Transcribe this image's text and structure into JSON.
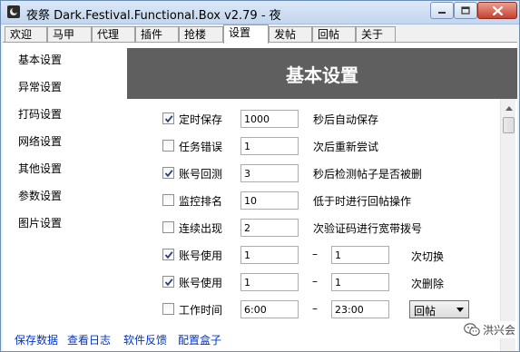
{
  "window": {
    "title": "夜祭 Dark.Festival.Functional.Box v2.79 -  夜"
  },
  "tabs": [
    {
      "label": "欢迎"
    },
    {
      "label": "马甲"
    },
    {
      "label": "代理"
    },
    {
      "label": "插件"
    },
    {
      "label": "抢楼"
    },
    {
      "label": "设置",
      "active": true
    },
    {
      "label": "发帖"
    },
    {
      "label": "回帖"
    },
    {
      "label": "关于"
    }
  ],
  "sidebar": {
    "items": [
      {
        "label": "基本设置"
      },
      {
        "label": "异常设置"
      },
      {
        "label": "打码设置"
      },
      {
        "label": "网络设置"
      },
      {
        "label": "其他设置"
      },
      {
        "label": "参数设置"
      },
      {
        "label": "图片设置"
      }
    ]
  },
  "panel": {
    "heading": "基本设置",
    "rows": [
      {
        "checked": true,
        "label": "定时保存",
        "value": "1000",
        "suffix": "秒后自动保存"
      },
      {
        "checked": false,
        "label": "任务错误",
        "value": "1",
        "suffix": "次后重新尝试"
      },
      {
        "checked": true,
        "label": "账号回测",
        "value": "3",
        "suffix": "秒后检测帖子是否被删"
      },
      {
        "checked": false,
        "label": "监控排名",
        "value": "10",
        "suffix": "低于时进行回帖操作"
      },
      {
        "checked": false,
        "label": "连续出现",
        "value": "2",
        "suffix": "次验证码进行宽带拨号"
      },
      {
        "checked": true,
        "label": "账号使用",
        "value": "1",
        "separator": "–",
        "value2": "1",
        "suffix": "次切换"
      },
      {
        "checked": true,
        "label": "账号使用",
        "value": "1",
        "separator": "–",
        "value2": "1",
        "suffix": "次删除"
      },
      {
        "checked": false,
        "label": "工作时间",
        "value": "6:00",
        "separator": "–",
        "value2": "23:00",
        "select": "回帖"
      }
    ]
  },
  "footer": {
    "links": [
      {
        "label": "保存数据"
      },
      {
        "label": "查看日志"
      },
      {
        "label": "软件反馈"
      },
      {
        "label": "配置盒子"
      }
    ]
  },
  "watermark": {
    "text": "洪兴会",
    "icon": "wechat-icon"
  },
  "colors": {
    "banner": "#5f5f5f",
    "link": "#0033cc",
    "close_button": "#c74130"
  }
}
